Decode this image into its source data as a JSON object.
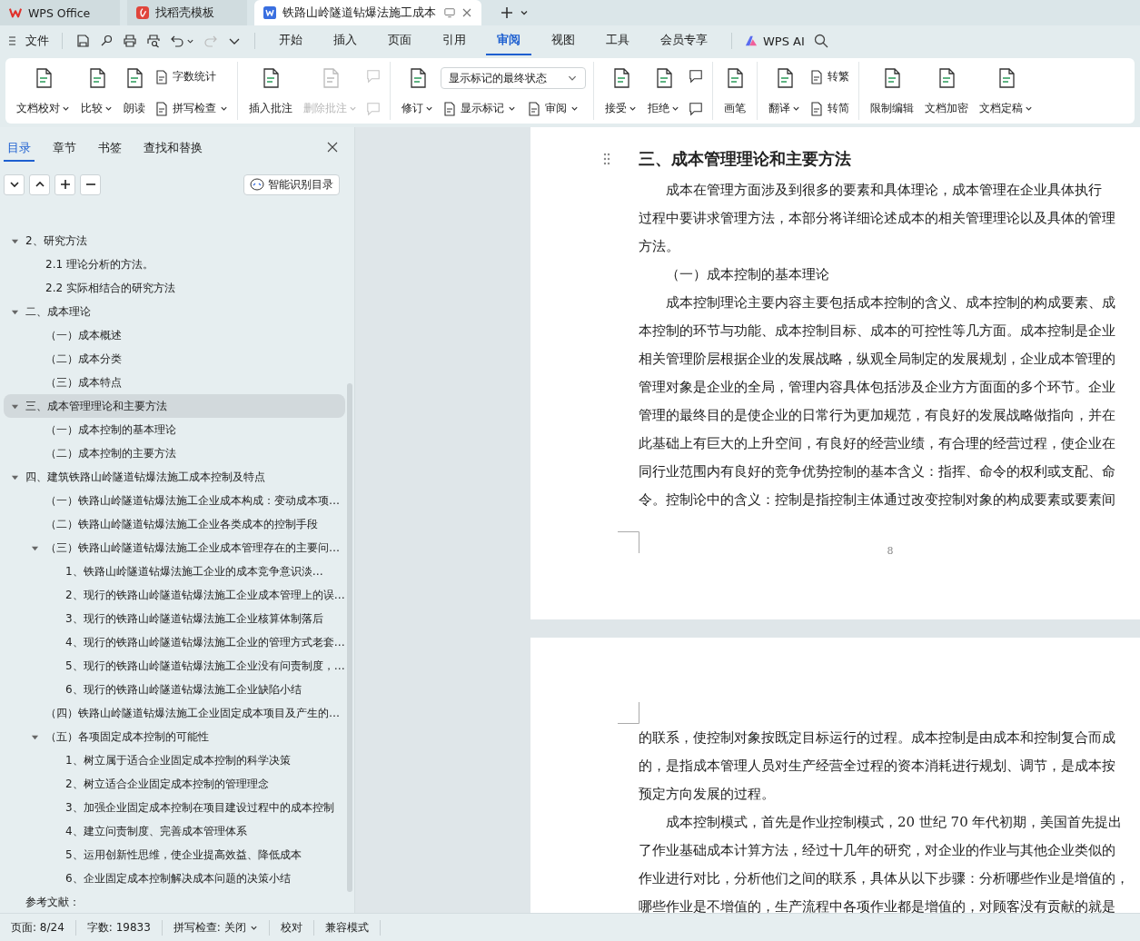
{
  "titlebar": {
    "tabs": [
      {
        "kind": "home",
        "label": "WPS Office",
        "selected": false
      },
      {
        "kind": "template",
        "label": "找稻壳模板",
        "selected": false
      },
      {
        "kind": "document",
        "label": "铁路山岭隧道钻爆法施工成本",
        "selected": true
      }
    ]
  },
  "menubar": {
    "file": "文件",
    "tabs": [
      {
        "label": "开始",
        "selected": false
      },
      {
        "label": "插入",
        "selected": false
      },
      {
        "label": "页面",
        "selected": false
      },
      {
        "label": "引用",
        "selected": false
      },
      {
        "label": "审阅",
        "selected": true
      },
      {
        "label": "视图",
        "selected": false
      },
      {
        "label": "工具",
        "selected": false
      },
      {
        "label": "会员专享",
        "selected": false
      }
    ],
    "ai": "WPS AI"
  },
  "ribbon": {
    "groups": [
      {
        "items": [
          {
            "kind": "large",
            "label": "文档校对",
            "dropdown": true,
            "disabled": false
          },
          {
            "kind": "large",
            "label": "比较",
            "dropdown": true,
            "disabled": false
          },
          {
            "kind": "large",
            "label": "朗读",
            "dropdown": false,
            "disabled": false
          },
          {
            "kind": "stack",
            "rows": [
              [
                {
                  "kind": "small",
                  "label": "字数统计",
                  "dropdown": false,
                  "disabled": false
                }
              ],
              [
                {
                  "kind": "small",
                  "label": "拼写检查",
                  "dropdown": true,
                  "disabled": false
                }
              ]
            ]
          }
        ]
      },
      {
        "items": [
          {
            "kind": "large",
            "label": "插入批注",
            "dropdown": false,
            "disabled": false
          },
          {
            "kind": "large",
            "label": "删除批注",
            "dropdown": true,
            "disabled": true
          },
          {
            "kind": "stack",
            "rows": [
              [
                {
                  "kind": "icon",
                  "dropdown": false,
                  "disabled": true
                }
              ],
              [
                {
                  "kind": "icon",
                  "dropdown": false,
                  "disabled": true
                }
              ]
            ]
          }
        ]
      },
      {
        "items": [
          {
            "kind": "large",
            "label": "修订",
            "dropdown": true,
            "disabled": false
          },
          {
            "kind": "stack",
            "rows": [
              [
                {
                  "kind": "select",
                  "label": "显示标记的最终状态",
                  "dropdown": true,
                  "disabled": false
                }
              ],
              [
                {
                  "kind": "small",
                  "label": "显示标记",
                  "dropdown": true,
                  "disabled": false
                },
                {
                  "kind": "small",
                  "label": "审阅",
                  "dropdown": true,
                  "disabled": false
                }
              ]
            ]
          }
        ]
      },
      {
        "items": [
          {
            "kind": "large",
            "label": "接受",
            "dropdown": true,
            "disabled": false
          },
          {
            "kind": "large",
            "label": "拒绝",
            "dropdown": true,
            "disabled": false
          },
          {
            "kind": "stack",
            "rows": [
              [
                {
                  "kind": "icon",
                  "dropdown": false,
                  "disabled": false
                }
              ],
              [
                {
                  "kind": "icon",
                  "dropdown": false,
                  "disabled": false
                }
              ]
            ]
          }
        ]
      },
      {
        "items": [
          {
            "kind": "large",
            "label": "画笔",
            "dropdown": false,
            "disabled": false
          }
        ]
      },
      {
        "items": [
          {
            "kind": "large",
            "label": "翻译",
            "dropdown": true,
            "disabled": false
          },
          {
            "kind": "stack",
            "rows": [
              [
                {
                  "kind": "small",
                  "label": "转繁",
                  "dropdown": false,
                  "disabled": false
                }
              ],
              [
                {
                  "kind": "small",
                  "label": "转简",
                  "dropdown": false,
                  "disabled": false
                }
              ]
            ]
          }
        ]
      },
      {
        "items": [
          {
            "kind": "large",
            "label": "限制编辑",
            "dropdown": false,
            "disabled": false
          },
          {
            "kind": "large",
            "label": "文档加密",
            "dropdown": false,
            "disabled": false
          },
          {
            "kind": "large",
            "label": "文档定稿",
            "dropdown": true,
            "disabled": false
          }
        ]
      }
    ]
  },
  "sidebar": {
    "tabs": [
      {
        "label": "目录",
        "selected": true
      },
      {
        "label": "章节",
        "selected": false
      },
      {
        "label": "书签",
        "selected": false
      },
      {
        "label": "查找和替换",
        "selected": false
      }
    ],
    "smart_button": "智能识别目录",
    "toc": [
      {
        "label": "2、研究方法",
        "selected": false,
        "expanded": true,
        "children": [
          {
            "label": "2.1 理论分析的方法。",
            "selected": false
          },
          {
            "label": "2.2 实际相结合的研究方法",
            "selected": false
          }
        ]
      },
      {
        "label": "二、成本理论",
        "selected": false,
        "expanded": true,
        "children": [
          {
            "label": "（一）成本概述",
            "selected": false
          },
          {
            "label": "（二）成本分类",
            "selected": false
          },
          {
            "label": "（三）成本特点",
            "selected": false
          }
        ]
      },
      {
        "label": "三、成本管理理论和主要方法",
        "selected": true,
        "expanded": true,
        "children": [
          {
            "label": "（一）成本控制的基本理论",
            "selected": false
          },
          {
            "label": "（二）成本控制的主要方法",
            "selected": false
          }
        ]
      },
      {
        "label": "四、建筑铁路山岭隧道钻爆法施工成本控制及特点",
        "selected": false,
        "expanded": true,
        "children": [
          {
            "label": "（一）铁路山岭隧道钻爆法施工企业成本构成：变动成本项…",
            "selected": false
          },
          {
            "label": "（二）铁路山岭隧道钻爆法施工企业各类成本的控制手段",
            "selected": false
          },
          {
            "label": "（三）铁路山岭隧道钻爆法施工企业成本管理存在的主要问…",
            "selected": false,
            "expanded": true,
            "children": [
              {
                "label": "1、铁路山岭隧道钻爆法施工企业的成本竞争意识淡…",
                "selected": false
              },
              {
                "label": "2、现行的铁路山岭隧道钻爆法施工企业成本管理上的误…",
                "selected": false
              },
              {
                "label": "3、现行的铁路山岭隧道钻爆法施工企业核算体制落后",
                "selected": false
              },
              {
                "label": "4、现行的铁路山岭隧道钻爆法施工企业的管理方式老套…",
                "selected": false
              },
              {
                "label": "5、现行的铁路山岭隧道钻爆法施工企业没有问责制度，…",
                "selected": false
              },
              {
                "label": "6、现行的铁路山岭隧道钻爆法施工企业缺陷小结",
                "selected": false
              }
            ]
          },
          {
            "label": "（四）铁路山岭隧道钻爆法施工企业固定成本项目及产生的…",
            "selected": false
          },
          {
            "label": "（五）各项固定成本控制的可能性",
            "selected": false,
            "expanded": true,
            "children": [
              {
                "label": "1、树立属于适合企业固定成本控制的科学决策",
                "selected": false
              },
              {
                "label": "2、树立适合企业固定成本控制的管理理念",
                "selected": false
              },
              {
                "label": "3、加强企业固定成本控制在项目建设过程中的成本控制",
                "selected": false
              },
              {
                "label": "4、建立问责制度、完善成本管理体系",
                "selected": false
              },
              {
                "label": "5、运用创新性思维，使企业提高效益、降低成本",
                "selected": false
              },
              {
                "label": "6、企业固定成本控制解决成本问题的决策小结",
                "selected": false
              }
            ]
          }
        ]
      },
      {
        "label": "参考文献：",
        "selected": false
      }
    ]
  },
  "document": {
    "pages": [
      {
        "page_number": "8",
        "blocks": [
          {
            "kind": "heading",
            "text": "三、成本管理理论和主要方法"
          },
          {
            "kind": "first-line",
            "text": "成本在管理方面涉及到很多的要素和具体理论，成本管理在企业具体执行"
          },
          {
            "kind": "line",
            "text": "过程中要讲求管理方法，本部分将详细论述成本的相关管理理论以及具体的管理"
          },
          {
            "kind": "line",
            "text": "方法。"
          },
          {
            "kind": "subheading",
            "text": "（一）成本控制的基本理论"
          },
          {
            "kind": "first-line",
            "text": "成本控制理论主要内容主要包括成本控制的含义、成本控制的构成要素、成"
          },
          {
            "kind": "line",
            "text": "本控制的环节与功能、成本控制目标、成本的可控性等几方面。成本控制是企业"
          },
          {
            "kind": "line",
            "text": "相关管理阶层根据企业的发展战略，纵观全局制定的发展规划，企业成本管理的"
          },
          {
            "kind": "line",
            "text": "管理对象是企业的全局，管理内容具体包括涉及企业方方面面的多个环节。企业"
          },
          {
            "kind": "line",
            "text": "管理的最终目的是使企业的日常行为更加规范，有良好的发展战略做指向，并在"
          },
          {
            "kind": "line",
            "text": "此基础上有巨大的上升空间，有良好的经营业绩，有合理的经营过程，使企业在"
          },
          {
            "kind": "line",
            "text": "同行业范围内有良好的竞争优势控制的基本含义：指挥、命令的权利或支配、命"
          },
          {
            "kind": "line",
            "text": "令。控制论中的含义：控制是指控制主体通过改变控制对象的构成要素或要素间"
          }
        ]
      },
      {
        "blocks": [
          {
            "kind": "line",
            "text": "的联系，使控制对象按既定目标运行的过程。成本控制是由成本和控制复合而成"
          },
          {
            "kind": "line",
            "text": "的，是指成本管理人员对生产经营全过程的资本消耗进行规划、调节，是成本按"
          },
          {
            "kind": "line",
            "text": "预定方向发展的过程。"
          },
          {
            "kind": "first-line",
            "text": "成本控制模式，首先是作业控制模式，20 世纪 70 年代初期，美国首先提出"
          },
          {
            "kind": "line",
            "text": "了作业基础成本计算方法，经过十几年的研究，对企业的作业与其他企业类似的"
          },
          {
            "kind": "line",
            "text": "作业进行对比，分析他们之间的联系，具体从以下步骤：分析哪些作业是增值的，"
          },
          {
            "kind": "line",
            "text": "哪些作业是不增值的，生产流程中各项作业都是增值的，对顾客没有贡献的就是"
          }
        ]
      }
    ]
  },
  "status_bar": [
    {
      "label": "页面: 8/24",
      "dropdown": false
    },
    {
      "label": "字数: 19833",
      "dropdown": false
    },
    {
      "label": "拼写检查: 关闭",
      "dropdown": true
    },
    {
      "label": "校对",
      "dropdown": false
    },
    {
      "label": "兼容模式",
      "dropdown": false
    }
  ]
}
